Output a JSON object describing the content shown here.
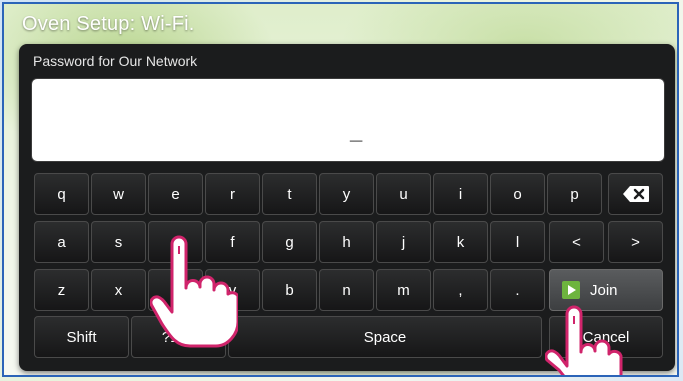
{
  "window": {
    "title": "Oven Setup: Wi-Fi."
  },
  "dialog": {
    "prompt": "Password for Our Network",
    "password_value": "_"
  },
  "keyboard": {
    "row1": [
      "q",
      "w",
      "e",
      "r",
      "t",
      "y",
      "u",
      "i",
      "o",
      "p"
    ],
    "row2": [
      "a",
      "s",
      "d",
      "f",
      "g",
      "h",
      "j",
      "k",
      "l"
    ],
    "row3": [
      "z",
      "x",
      "c",
      "v",
      "b",
      "n",
      "m",
      ",",
      "."
    ],
    "left_arrow": "<",
    "right_arrow": ">",
    "join_label": "Join",
    "shift_label": "Shift",
    "symbols_label": "?123",
    "space_label": "Space",
    "cancel_label": "Cancel"
  },
  "colors": {
    "frame_border": "#2b64b8",
    "panel": "#1b1c1d",
    "join_accent": "#6db43e",
    "hand_outline": "#d0246b"
  },
  "icons": [
    "backspace-icon",
    "play-icon",
    "pointing-hand-icon"
  ]
}
